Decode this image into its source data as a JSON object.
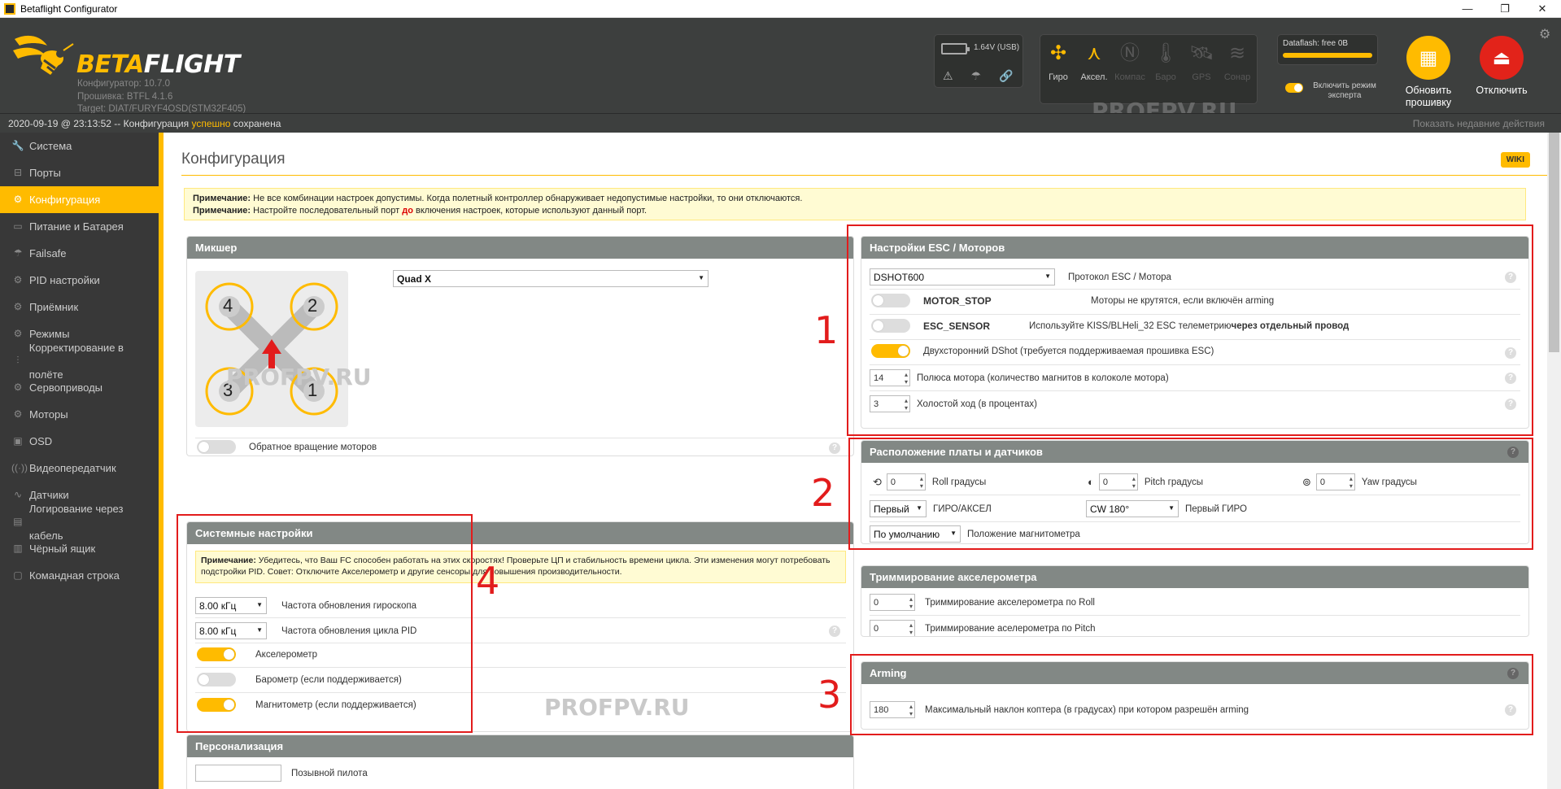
{
  "window": {
    "title": "Betaflight Configurator",
    "minimize": "—",
    "maximize": "❐",
    "close": "✕"
  },
  "header": {
    "logo_beta": "BETA",
    "logo_flight": "FLIGHT",
    "configurator_version": "Конфигуратор: 10.7.0",
    "firmware_version": "Прошивка: BTFL 4.1.6",
    "target": "Target: DIAT/FURYF4OSD(STM32F405)",
    "voltage": "1.64V (USB)",
    "sensors": [
      {
        "label": "Гиро",
        "icon": "gyro-icon",
        "glyph": "✣",
        "active": true
      },
      {
        "label": "Аксел.",
        "icon": "accel-icon",
        "glyph": "⋏",
        "active": true
      },
      {
        "label": "Компас",
        "icon": "compass-icon",
        "glyph": "Ⓝ",
        "active": false
      },
      {
        "label": "Баро",
        "icon": "baro-icon",
        "glyph": "🌡",
        "active": false
      },
      {
        "label": "GPS",
        "icon": "gps-icon",
        "glyph": "🛰",
        "active": false
      },
      {
        "label": "Сонар",
        "icon": "sonar-icon",
        "glyph": "≋",
        "active": false
      }
    ],
    "dataflash": "Dataflash: free 0B",
    "expert_mode": "Включить режим эксперта",
    "flash_button": "Обновить прошивку",
    "disconnect_button": "Отключить",
    "watermark": "PROFPV.RU"
  },
  "status": {
    "prefix": "2020-09-19 @ 23:13:52 -- Конфигурация ",
    "ok_word": "успешно",
    "suffix": " сохранена",
    "recent_actions": "Показать недавние действия"
  },
  "sidebar": {
    "items": [
      {
        "label": "Система",
        "icon": "wrench-icon",
        "glyph": "🔧",
        "active": false
      },
      {
        "label": "Порты",
        "icon": "ports-icon",
        "glyph": "⊟",
        "active": false
      },
      {
        "label": "Конфигурация",
        "icon": "gear-icon",
        "glyph": "⚙",
        "active": true
      },
      {
        "label": "Питание и Батарея",
        "icon": "battery-icon",
        "glyph": "▭",
        "active": false
      },
      {
        "label": "Failsafe",
        "icon": "failsafe-icon",
        "glyph": "☂",
        "active": false
      },
      {
        "label": "PID настройки",
        "icon": "pid-icon",
        "glyph": "⚙",
        "active": false
      },
      {
        "label": "Приёмник",
        "icon": "receiver-icon",
        "glyph": "⚙",
        "active": false
      },
      {
        "label": "Режимы",
        "icon": "modes-icon",
        "glyph": "⚙",
        "active": false
      },
      {
        "label": "Корректирование в полёте",
        "icon": "adjustments-icon",
        "glyph": "⫶",
        "active": false
      },
      {
        "label": "Сервоприводы",
        "icon": "servo-icon",
        "glyph": "⚙",
        "active": false
      },
      {
        "label": "Моторы",
        "icon": "motors-icon",
        "glyph": "⚙",
        "active": false
      },
      {
        "label": "OSD",
        "icon": "osd-icon",
        "glyph": "▣",
        "active": false
      },
      {
        "label": "Видеопередатчик",
        "icon": "vtx-icon",
        "glyph": "((·))",
        "active": false
      },
      {
        "label": "Датчики",
        "icon": "sensors-icon",
        "glyph": "∿",
        "active": false
      },
      {
        "label": "Логирование через кабель",
        "icon": "log-icon",
        "glyph": "▤",
        "active": false
      },
      {
        "label": "Чёрный ящик",
        "icon": "blackbox-icon",
        "glyph": "▥",
        "active": false
      },
      {
        "label": "Командная строка",
        "icon": "cli-icon",
        "glyph": "▢",
        "active": false
      }
    ]
  },
  "page": {
    "title": "Конфигурация",
    "wiki": "WIKI",
    "note1_bold": "Примечание:",
    "note1_text": " Не все комбинации настроек допустимы. Когда полетный контроллер обнаруживает недопустимые настройки, то они отключаются.",
    "note2_bold": "Примечание:",
    "note2_text_a": " Настройте последовательный порт ",
    "note2_red": "до",
    "note2_text_b": " включения настроек, которые используют данный порт."
  },
  "mixer": {
    "header": "Микшер",
    "type": "Quad X",
    "motors": [
      "4",
      "2",
      "3",
      "1"
    ],
    "reverse_label": "Обратное вращение моторов",
    "reverse_on": false
  },
  "system": {
    "header": "Системные настройки",
    "note_bold": "Примечание:",
    "note_text": " Убедитесь, что Ваш FC способен работать на этих скоростях! Проверьте ЦП и стабильность времени цикла. Эти изменения могут потребовать подстройки PID. Совет: Отключите Акселерометр и другие сенсоры для повышения производительности.",
    "gyro_rate": "8.00 кГц",
    "gyro_rate_label": "Частота обновления гироскопа",
    "pid_rate": "8.00 кГц",
    "pid_rate_label": "Частота обновления цикла PID",
    "accel_label": "Акселерометр",
    "accel_on": true,
    "baro_label": "Барометр (если поддерживается)",
    "baro_on": false,
    "mag_label": "Магнитометр (если поддерживается)",
    "mag_on": true
  },
  "personal": {
    "header": "Персонализация",
    "callsign_label": "Позывной пилота",
    "callsign_value": ""
  },
  "esc": {
    "header": "Настройки ESC / Моторов",
    "protocol": "DSHOT600",
    "protocol_label": "Протокол ESC / Мотора",
    "motor_stop": "MOTOR_STOP",
    "motor_stop_desc": "Моторы не крутятся, если включён arming",
    "motor_stop_on": false,
    "esc_sensor": "ESC_SENSOR",
    "esc_sensor_desc_a": "Используйте KISS/BLHeli_32 ESC телеметрию ",
    "esc_sensor_desc_b": "через отдельный провод",
    "esc_sensor_on": false,
    "bidir_label": "Двухсторонний DShot (требуется поддерживаемая прошивка ESC)",
    "bidir_on": true,
    "poles": "14",
    "poles_label": "Полюса мотора (количество магнитов в колоколе мотора)",
    "idle": "3",
    "idle_label": "Холостой ход (в процентах)"
  },
  "board": {
    "header": "Расположение платы и датчиков",
    "roll": "0",
    "roll_label": "Roll градусы",
    "pitch": "0",
    "pitch_label": "Pitch градусы",
    "yaw": "0",
    "yaw_label": "Yaw градусы",
    "gyro_select": "Первый",
    "gyro_select_label": "ГИРО/АКСЕЛ",
    "gyro_align": "CW 180°",
    "gyro_align_label": "Первый ГИРО",
    "mag_align": "По умолчанию",
    "mag_align_label": "Положение магнитометра"
  },
  "trim": {
    "header": "Триммирование акселерометра",
    "roll": "0",
    "roll_label": "Триммирование акселерометра по Roll",
    "pitch": "0",
    "pitch_label": "Триммирование аселерометра по Pitch"
  },
  "arming": {
    "header": "Arming",
    "angle": "180",
    "angle_label": "Максимальный наклон коптера (в градусах) при котором разрешён arming"
  },
  "annotations": {
    "n1": "1",
    "n2": "2",
    "n3": "3",
    "n4": "4"
  },
  "help_glyph": "?"
}
